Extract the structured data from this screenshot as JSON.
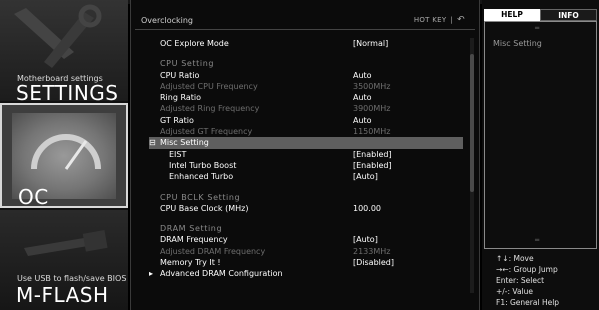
{
  "sidebar": {
    "settings": {
      "small": "Motherboard settings",
      "big": "SETTINGS"
    },
    "oc": {
      "big": "OC"
    },
    "mflash": {
      "small": "Use USB to flash/save BIOS",
      "big": "M-FLASH"
    }
  },
  "main": {
    "breadcrumb": "Overclocking",
    "hotkey": "HOT KEY",
    "hotkey_sep": "|",
    "back_icon": "↶",
    "oc_explore_mode": {
      "label": "OC Explore Mode",
      "value": "[Normal]"
    },
    "cpu_setting": {
      "heading": "CPU  Setting"
    },
    "cpu_ratio": {
      "label": "CPU Ratio",
      "value": "Auto"
    },
    "adj_cpu_freq": {
      "label": "Adjusted CPU Frequency",
      "value": "3500MHz"
    },
    "ring_ratio": {
      "label": "Ring Ratio",
      "value": "Auto"
    },
    "adj_ring_freq": {
      "label": "Adjusted Ring Frequency",
      "value": "3900MHz"
    },
    "gt_ratio": {
      "label": "GT Ratio",
      "value": "Auto"
    },
    "adj_gt_freq": {
      "label": "Adjusted GT Frequency",
      "value": "1150MHz"
    },
    "misc_setting": {
      "prefix": "⊟",
      "label": "Misc Setting"
    },
    "eist": {
      "label": "EIST",
      "value": "[Enabled]"
    },
    "turbo_boost": {
      "label": "Intel Turbo Boost",
      "value": "[Enabled]"
    },
    "enhanced_turbo": {
      "label": "Enhanced Turbo",
      "value": "[Auto]"
    },
    "cpu_bclk_setting": {
      "heading": "CPU  BCLK  Setting"
    },
    "cpu_base_clock": {
      "label": "CPU Base Clock (MHz)",
      "value": "100.00"
    },
    "dram_setting": {
      "heading": "DRAM  Setting"
    },
    "dram_freq": {
      "label": "DRAM Frequency",
      "value": "[Auto]"
    },
    "adj_dram_freq": {
      "label": "Adjusted DRAM Frequency",
      "value": "2133MHz"
    },
    "memory_try_it": {
      "label": "Memory Try It !",
      "value": "[Disabled]"
    },
    "adv_dram": {
      "prefix": "▸",
      "label": "Advanced DRAM Configuration"
    }
  },
  "help": {
    "tab_help": "HELP",
    "tab_info": "INFO",
    "text": "Misc Setting",
    "keys": [
      "↑↓: Move",
      "→←: Group Jump",
      "Enter: Select",
      "+/-: Value",
      "F1: General Help"
    ],
    "up_arrow": "═",
    "down_arrow": "═"
  }
}
